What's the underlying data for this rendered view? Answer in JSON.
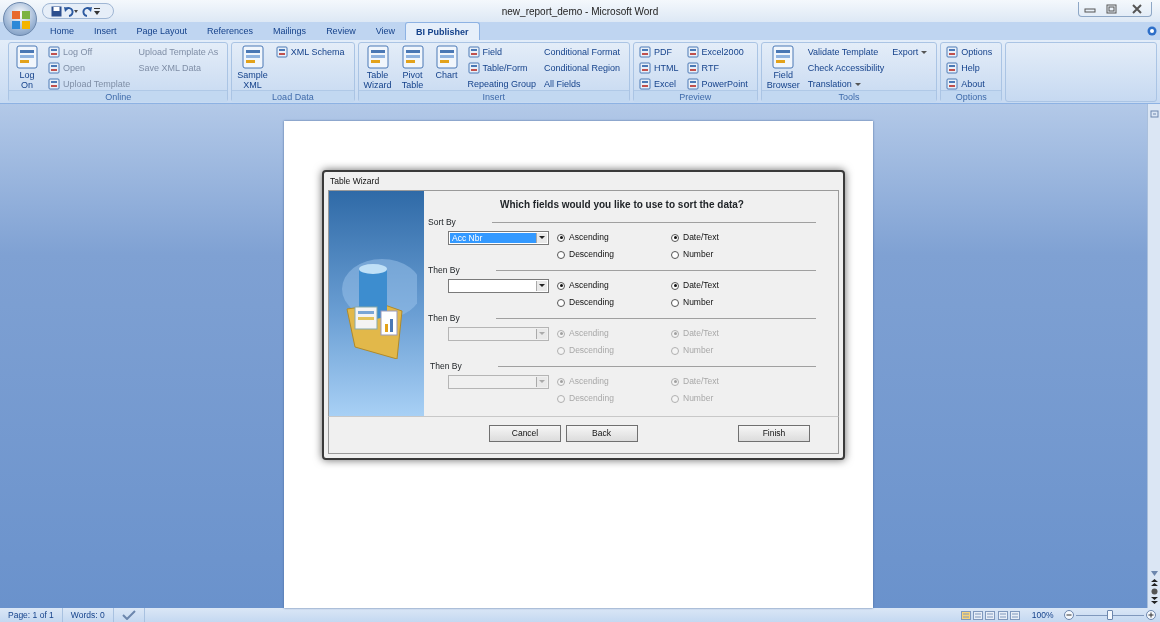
{
  "window": {
    "title": "new_report_demo - Microsoft Word"
  },
  "tabs": [
    {
      "label": "Home",
      "selected": false
    },
    {
      "label": "Insert",
      "selected": false
    },
    {
      "label": "Page Layout",
      "selected": false
    },
    {
      "label": "References",
      "selected": false
    },
    {
      "label": "Mailings",
      "selected": false
    },
    {
      "label": "Review",
      "selected": false
    },
    {
      "label": "View",
      "selected": false
    },
    {
      "label": "BI Publisher",
      "selected": true
    }
  ],
  "ribbon": {
    "groups": [
      {
        "label": "Online",
        "columns": [
          [
            {
              "label": "Log On",
              "kind": "large",
              "disabled": false
            }
          ],
          [
            {
              "label": "Log Off",
              "kind": "small",
              "disabled": true
            },
            {
              "label": "Open",
              "kind": "small",
              "disabled": true
            },
            {
              "label": "Upload Template",
              "kind": "small",
              "disabled": true
            }
          ],
          [
            {
              "label": "Upload Template As",
              "kind": "text",
              "disabled": true
            },
            {
              "label": "Save XML Data",
              "kind": "text",
              "disabled": true
            }
          ]
        ]
      },
      {
        "label": "Load Data",
        "columns": [
          [
            {
              "label": "Sample XML",
              "kind": "large",
              "disabled": false
            }
          ],
          [
            {
              "label": "XML Schema",
              "kind": "small",
              "disabled": false
            }
          ]
        ]
      },
      {
        "label": "Insert",
        "columns": [
          [
            {
              "label": "Table Wizard",
              "kind": "large",
              "disabled": false
            }
          ],
          [
            {
              "label": "Pivot Table",
              "kind": "large",
              "disabled": false
            }
          ],
          [
            {
              "label": "Chart",
              "kind": "large",
              "disabled": false
            }
          ],
          [
            {
              "label": "Field",
              "kind": "small",
              "disabled": false
            },
            {
              "label": "Table/Form",
              "kind": "small",
              "disabled": false
            },
            {
              "label": "Repeating Group",
              "kind": "text",
              "disabled": false
            }
          ],
          [
            {
              "label": "Conditional Format",
              "kind": "text",
              "disabled": false
            },
            {
              "label": "Conditional Region",
              "kind": "text",
              "disabled": false
            },
            {
              "label": "All Fields",
              "kind": "text",
              "disabled": false
            }
          ]
        ]
      },
      {
        "label": "Preview",
        "columns": [
          [
            {
              "label": "PDF",
              "kind": "small",
              "disabled": false
            },
            {
              "label": "HTML",
              "kind": "small",
              "disabled": false
            },
            {
              "label": "Excel",
              "kind": "small",
              "disabled": false
            }
          ],
          [
            {
              "label": "Excel2000",
              "kind": "small",
              "disabled": false
            },
            {
              "label": "RTF",
              "kind": "small",
              "disabled": false
            },
            {
              "label": "PowerPoint",
              "kind": "small",
              "disabled": false
            }
          ]
        ]
      },
      {
        "label": "Tools",
        "columns": [
          [
            {
              "label": "Field Browser",
              "kind": "large",
              "disabled": false
            }
          ],
          [
            {
              "label": "Validate Template",
              "kind": "text",
              "disabled": false
            },
            {
              "label": "Check Accessibility",
              "kind": "text",
              "disabled": false
            },
            {
              "label": "Translation",
              "kind": "menu",
              "disabled": false
            }
          ],
          [
            {
              "label": "Export",
              "kind": "menu",
              "disabled": false
            }
          ]
        ]
      },
      {
        "label": "Options",
        "columns": [
          [
            {
              "label": "Options",
              "kind": "small",
              "disabled": false
            },
            {
              "label": "Help",
              "kind": "small",
              "disabled": false
            },
            {
              "label": "About",
              "kind": "small",
              "disabled": false
            }
          ]
        ]
      }
    ]
  },
  "dialog": {
    "title": "Table Wizard",
    "heading": "Which fields would you like to use to sort the data?",
    "sections": [
      {
        "label": "Sort By",
        "disabled": false,
        "field": {
          "value": "Acc Nbr",
          "highlighted": true
        },
        "order": [
          {
            "label": "Ascending",
            "selected": true
          },
          {
            "label": "Descending",
            "selected": false
          }
        ],
        "type": [
          {
            "label": "Date/Text",
            "selected": true
          },
          {
            "label": "Number",
            "selected": false
          }
        ]
      },
      {
        "label": "Then By",
        "disabled": false,
        "order": [
          {
            "label": "Ascending",
            "selected": true
          },
          {
            "label": "Descending",
            "selected": false
          }
        ],
        "type": [
          {
            "label": "Date/Text",
            "selected": true
          },
          {
            "label": "Number",
            "selected": false
          }
        ]
      },
      {
        "label": "Then By",
        "disabled": true,
        "order": [
          {
            "label": "Ascending",
            "selected": true
          },
          {
            "label": "Descending",
            "selected": false
          }
        ],
        "type": [
          {
            "label": "Date/Text",
            "selected": true
          },
          {
            "label": "Number",
            "selected": false
          }
        ]
      },
      {
        "label": "Then By",
        "disabled": true,
        "order": [
          {
            "label": "Ascending",
            "selected": true
          },
          {
            "label": "Descending",
            "selected": false
          }
        ],
        "type": [
          {
            "label": "Date/Text",
            "selected": true
          },
          {
            "label": "Number",
            "selected": false
          }
        ]
      }
    ],
    "buttons": [
      "Cancel",
      "Back",
      "Finish"
    ]
  },
  "status_bar": {
    "page": "Page: 1 of 1",
    "words": "Words: 0",
    "zoom": "100%",
    "zoom_slider": {
      "level": 0.5
    }
  }
}
